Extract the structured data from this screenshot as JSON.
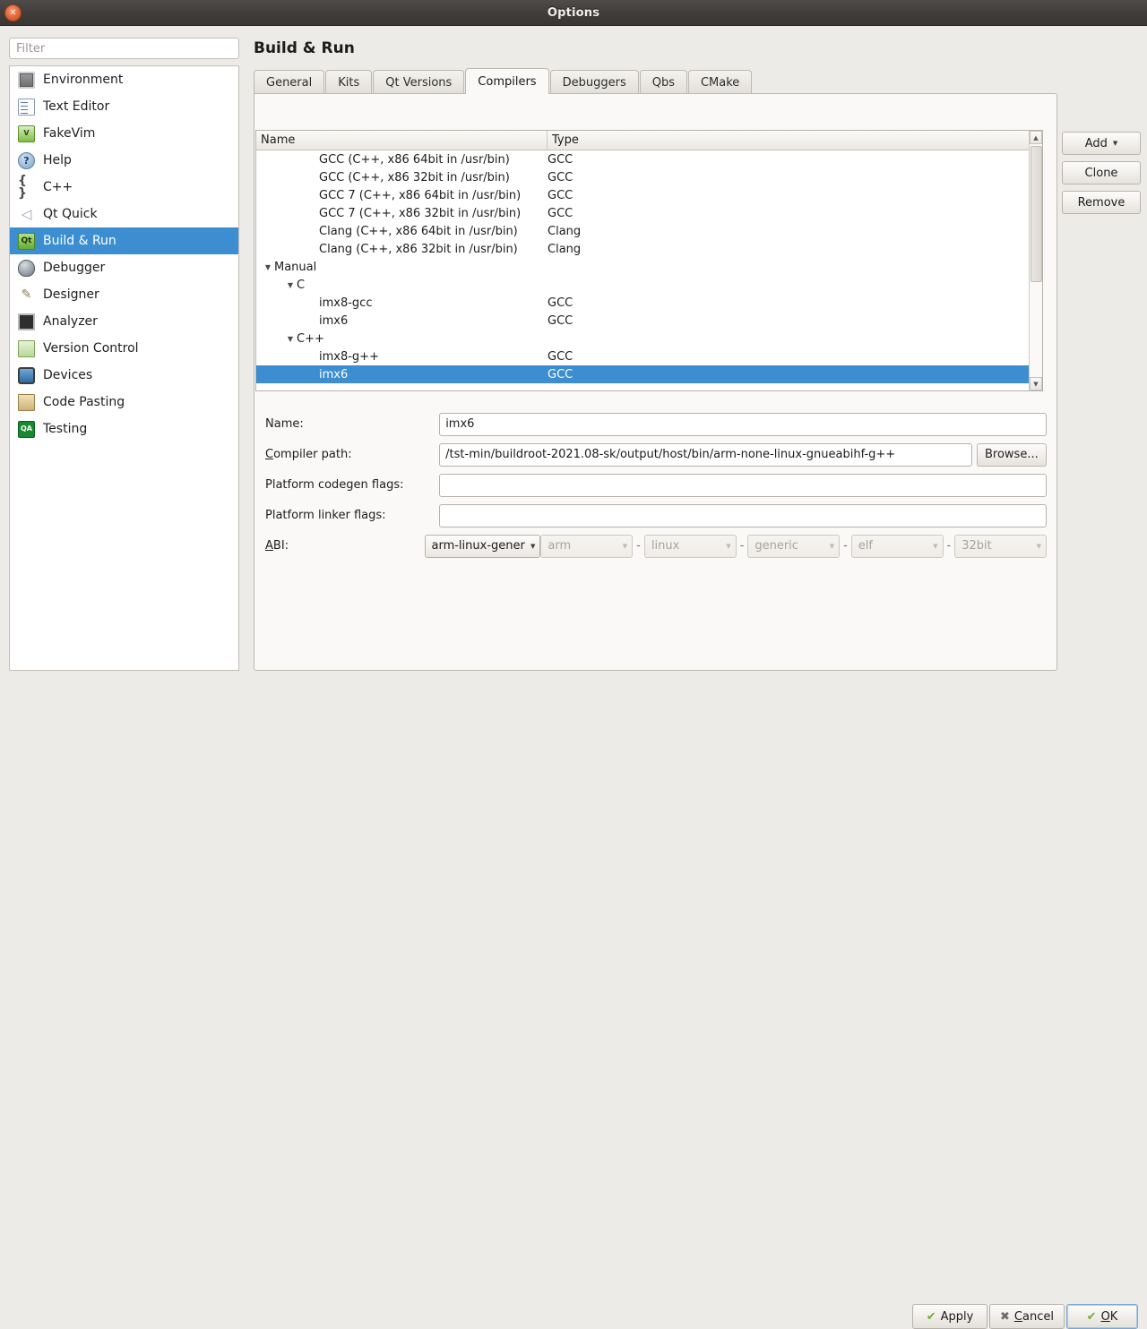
{
  "window": {
    "title": "Options",
    "close_icon": "close-icon"
  },
  "sidebar": {
    "filter_placeholder": "Filter",
    "items": [
      {
        "label": "Environment",
        "icon": "monitor-icon"
      },
      {
        "label": "Text Editor",
        "icon": "document-text-icon"
      },
      {
        "label": "FakeVim",
        "icon": "fakevim-icon"
      },
      {
        "label": "Help",
        "icon": "question-mark-icon"
      },
      {
        "label": "C++",
        "icon": "braces-icon"
      },
      {
        "label": "Qt Quick",
        "icon": "paper-plane-icon"
      },
      {
        "label": "Build & Run",
        "icon": "qt-hammer-icon",
        "selected": true
      },
      {
        "label": "Debugger",
        "icon": "bug-icon"
      },
      {
        "label": "Designer",
        "icon": "paintbrush-icon"
      },
      {
        "label": "Analyzer",
        "icon": "chart-screen-icon"
      },
      {
        "label": "Version Control",
        "icon": "copy-pages-icon"
      },
      {
        "label": "Devices",
        "icon": "phone-icon"
      },
      {
        "label": "Code Pasting",
        "icon": "clipboard-globe-icon"
      },
      {
        "label": "Testing",
        "icon": "qa-badge-icon"
      }
    ]
  },
  "page": {
    "title": "Build & Run",
    "tabs": [
      {
        "label": "General",
        "active": false
      },
      {
        "label": "Kits",
        "active": false
      },
      {
        "label": "Qt Versions",
        "active": false
      },
      {
        "label": "Compilers",
        "active": true
      },
      {
        "label": "Debuggers",
        "active": false
      },
      {
        "label": "Qbs",
        "active": false
      },
      {
        "label": "CMake",
        "active": false
      }
    ]
  },
  "compiler_tree": {
    "columns": [
      "Name",
      "Type"
    ],
    "rows": [
      {
        "name": "GCC (C++, x86 64bit in /usr/bin)",
        "type": "GCC",
        "indent": 2,
        "twisty": "",
        "selected": false
      },
      {
        "name": "GCC (C++, x86 32bit in /usr/bin)",
        "type": "GCC",
        "indent": 2,
        "twisty": "",
        "selected": false
      },
      {
        "name": "GCC 7 (C++, x86 64bit in /usr/bin)",
        "type": "GCC",
        "indent": 2,
        "twisty": "",
        "selected": false
      },
      {
        "name": "GCC 7 (C++, x86 32bit in /usr/bin)",
        "type": "GCC",
        "indent": 2,
        "twisty": "",
        "selected": false
      },
      {
        "name": "Clang (C++, x86 64bit in /usr/bin)",
        "type": "Clang",
        "indent": 2,
        "twisty": "",
        "selected": false
      },
      {
        "name": "Clang (C++, x86 32bit in /usr/bin)",
        "type": "Clang",
        "indent": 2,
        "twisty": "",
        "selected": false
      },
      {
        "name": "Manual",
        "type": "",
        "indent": 0,
        "twisty": "▼",
        "selected": false
      },
      {
        "name": "C",
        "type": "",
        "indent": 1,
        "twisty": "▼",
        "selected": false
      },
      {
        "name": "imx8-gcc",
        "type": "GCC",
        "indent": 2,
        "twisty": "",
        "selected": false
      },
      {
        "name": "imx6",
        "type": "GCC",
        "indent": 2,
        "twisty": "",
        "selected": false
      },
      {
        "name": "C++",
        "type": "",
        "indent": 1,
        "twisty": "▼",
        "selected": false
      },
      {
        "name": "imx8-g++",
        "type": "GCC",
        "indent": 2,
        "twisty": "",
        "selected": false
      },
      {
        "name": "imx6",
        "type": "GCC",
        "indent": 2,
        "twisty": "",
        "selected": true
      }
    ]
  },
  "side_buttons": {
    "add": "Add",
    "add_caret": "▼",
    "clone": "Clone",
    "remove": "Remove"
  },
  "form": {
    "name_label": "Name:",
    "name_value": "imx6",
    "path_label": "Compiler path:",
    "path_value": "/tst-min/buildroot-2021.08-sk/output/host/bin/arm-none-linux-gnueabihf-g++",
    "browse_label": "Browse...",
    "codegen_label": "Platform codegen flags:",
    "codegen_value": "",
    "linker_label": "Platform linker flags:",
    "linker_value": "",
    "abi_label": "ABI:",
    "abi_main": "arm-linux-gener",
    "abi_arch": "arm",
    "abi_os": "linux",
    "abi_osflavor": "generic",
    "abi_binaryformat": "elf",
    "abi_wordwidth": "32bit",
    "separator": "-",
    "combo_arrow": "▼"
  },
  "dialog_buttons": {
    "apply": "Apply",
    "cancel": "Cancel",
    "ok": "OK",
    "check_glyph": "✔",
    "x_glyph": "✖"
  },
  "colors": {
    "selection_blue": "#3c8ed0",
    "dialog_bg": "#edebe7",
    "panel_bg": "#fbf9f7",
    "titlebar": "#413d3a",
    "close_orange": "#e0653a"
  }
}
